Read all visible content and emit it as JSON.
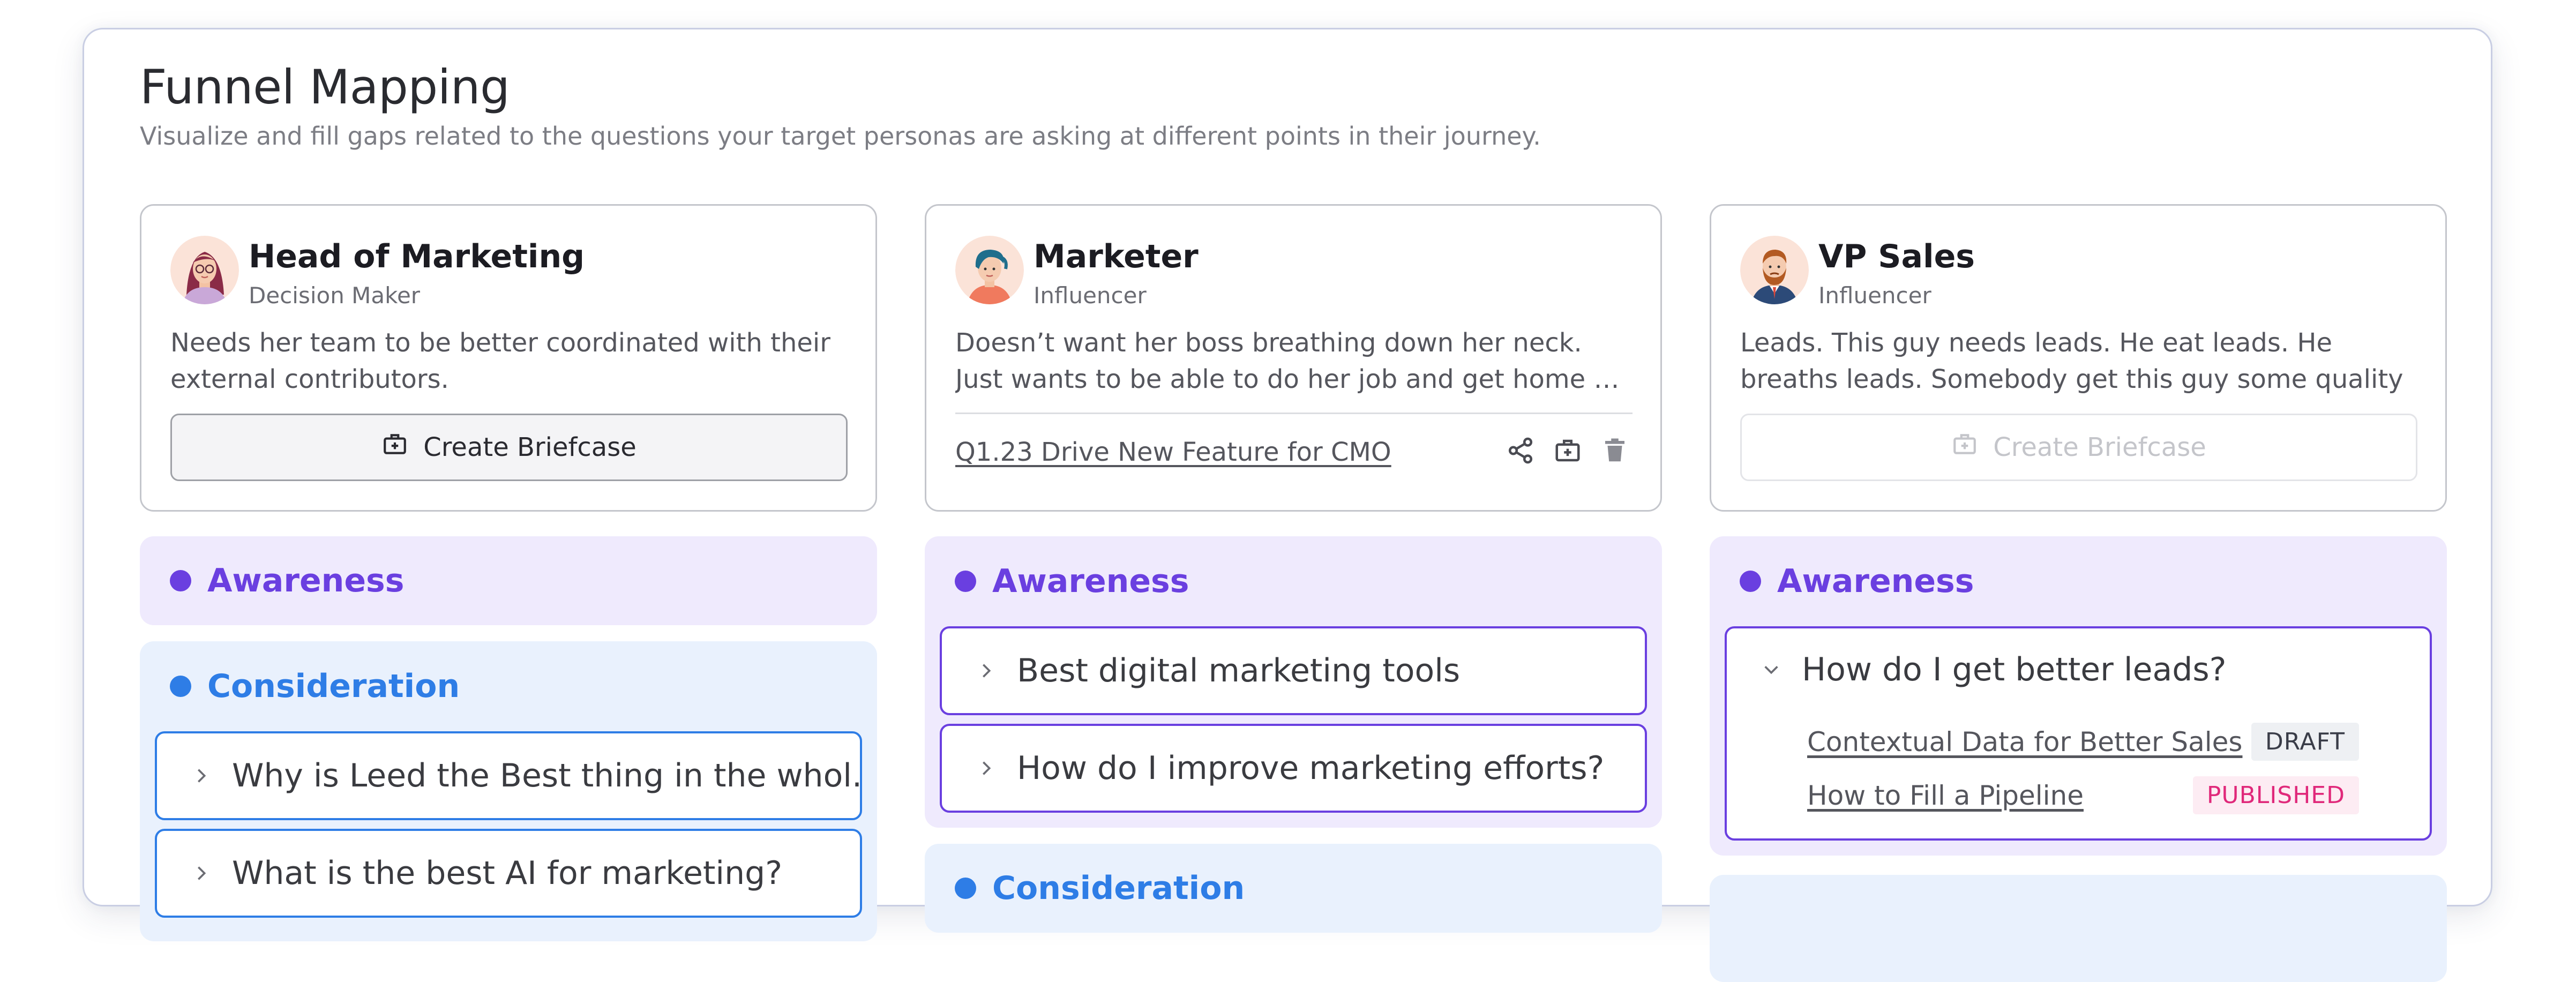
{
  "page": {
    "title": "Funnel Mapping",
    "subtitle": "Visualize and fill gaps related to the questions your target personas are asking at different points in their journey."
  },
  "personas": [
    {
      "name": "Head of Marketing",
      "role": "Decision Maker",
      "description": "Needs her team to be better coordinated with their external contributors.",
      "button_label": "Create Briefcase",
      "button_enabled": true,
      "stages": [
        {
          "name": "Awareness",
          "color": "#6a3fe0",
          "questions": []
        },
        {
          "name": "Consideration",
          "color": "#2e7de6",
          "questions": [
            "Why is Leed the Best thing in the whol...",
            "What is the best AI for marketing?"
          ]
        }
      ]
    },
    {
      "name": "Marketer",
      "role": "Influencer",
      "description": "Doesn’t want her boss breathing down her neck. Just wants to be able to do her job and get home as efficiently as possible.",
      "briefcase_link": "Q1.23 Drive New Feature for CMO",
      "icons": [
        "share-icon",
        "briefcase-icon",
        "trash-icon"
      ],
      "stages": [
        {
          "name": "Awareness",
          "color": "#6a3fe0",
          "questions": [
            "Best digital marketing tools",
            "How do I improve marketing efforts?"
          ]
        },
        {
          "name": "Consideration",
          "color": "#2e7de6",
          "questions": []
        }
      ]
    },
    {
      "name": "VP Sales",
      "role": "Influencer",
      "description": "Leads. This guy needs leads. He eat leads. He breaths leads. Somebody get this guy some quality leads!",
      "button_label": "Create Briefcase",
      "button_enabled": false,
      "stages": [
        {
          "name": "Awareness",
          "color": "#6a3fe0",
          "expanded_question": {
            "text": "How do I get better leads?",
            "assets": [
              {
                "title": "Contextual Data for Better Sales",
                "status": "DRAFT"
              },
              {
                "title": "How to Fill a Pipeline",
                "status": "PUBLISHED"
              }
            ]
          }
        }
      ]
    }
  ],
  "colors": {
    "awareness": "#6a3fe0",
    "consideration": "#2e7de6",
    "published": "#e0287a",
    "panel_border": "#c9cee3"
  }
}
